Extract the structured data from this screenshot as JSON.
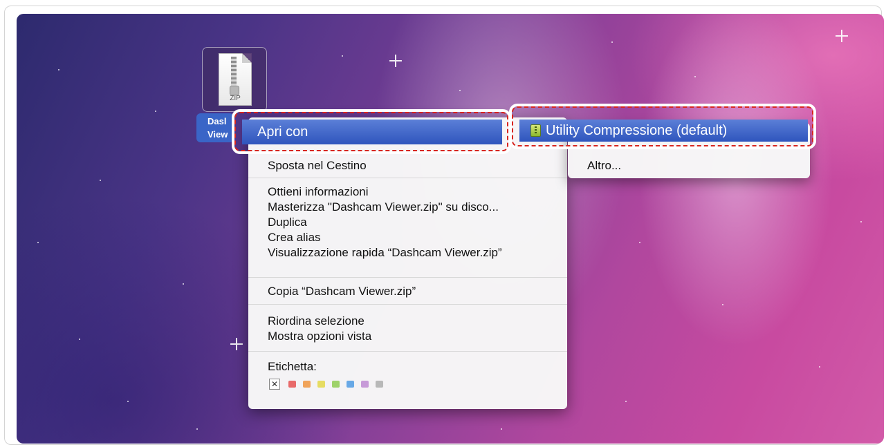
{
  "file": {
    "icon_text": "ZIP",
    "label_line1": "Dasl",
    "label_line2": "View"
  },
  "context_menu": {
    "open_with_label": "Apri con",
    "move_to_trash_label": "Sposta nel Cestino",
    "get_info_label": "Ottieni informazioni",
    "burn_label": "Masterizza \"Dashcam Viewer.zip\" su disco...",
    "duplicate_label": "Duplica",
    "make_alias_label": "Crea alias",
    "quick_look_label": "Visualizzazione rapida “Dashcam Viewer.zip”",
    "copy_label": "Copia “Dashcam Viewer.zip”",
    "clean_up_label": "Riordina selezione",
    "show_view_options_label": "Mostra opzioni vista",
    "label_heading": "Etichetta:",
    "label_remove_symbol": "✕",
    "label_colors": [
      "#e86a6a",
      "#f0a35a",
      "#e6dc62",
      "#9ed26a",
      "#68a8e6",
      "#c79ad8",
      "#b8b8b8"
    ]
  },
  "submenu": {
    "default_app_label": "Utility Compressione (default)",
    "other_label": "Altro..."
  },
  "colors": {
    "highlight": "#3a62c9",
    "callout": "#d8251f"
  }
}
